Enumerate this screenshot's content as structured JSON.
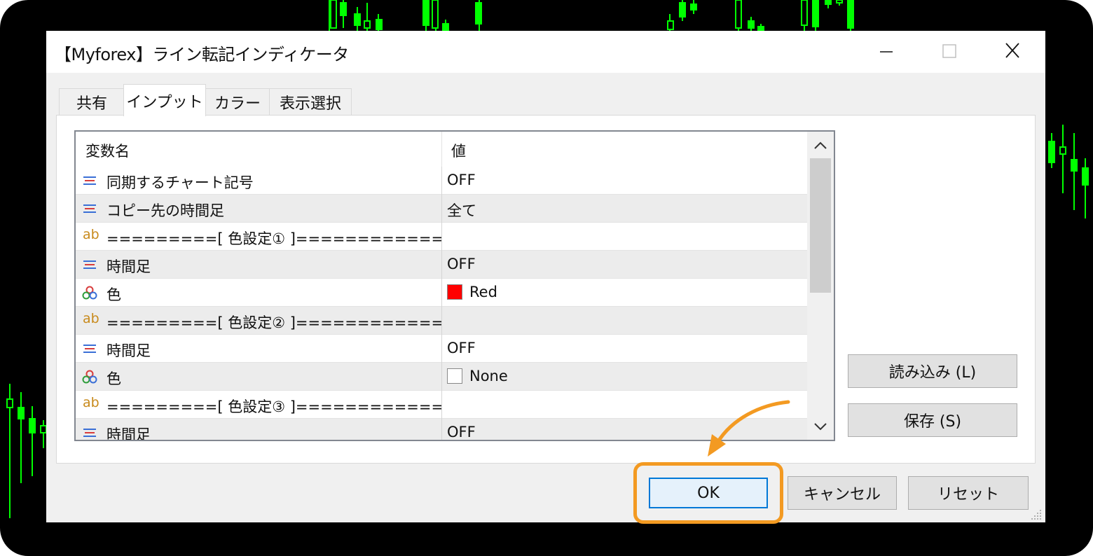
{
  "window": {
    "title": "【Myforex】ライン転記インディケータ",
    "controls": [
      "minimize",
      "maximize",
      "close"
    ]
  },
  "tabs": [
    {
      "label": "共有",
      "active": false
    },
    {
      "label": "インプット",
      "active": true
    },
    {
      "label": "カラー",
      "active": false
    },
    {
      "label": "表示選択",
      "active": false
    }
  ],
  "grid": {
    "columns": [
      "変数名",
      "値"
    ],
    "rows": [
      {
        "icon": "list-lines-icon",
        "name": "同期するチャート記号",
        "value": "OFF"
      },
      {
        "icon": "list-lines-icon",
        "name": "コピー先の時間足",
        "value": "全て"
      },
      {
        "icon": "ab-string-icon",
        "icon_text": "ab",
        "name": "=========[ 色設定① ]============",
        "value": ""
      },
      {
        "icon": "list-lines-icon",
        "name": "時間足",
        "value": "OFF"
      },
      {
        "icon": "color-circles-icon",
        "name": "色",
        "value": "Red",
        "swatch": "#ff0000"
      },
      {
        "icon": "ab-string-icon",
        "icon_text": "ab",
        "name": "=========[ 色設定② ]============",
        "value": ""
      },
      {
        "icon": "list-lines-icon",
        "name": "時間足",
        "value": "OFF"
      },
      {
        "icon": "color-circles-icon",
        "name": "色",
        "value": "None",
        "swatch": "#ffffff"
      },
      {
        "icon": "ab-string-icon",
        "icon_text": "ab",
        "name": "=========[ 色設定③ ]============",
        "value": ""
      },
      {
        "icon": "list-lines-icon",
        "name": "時間足",
        "value": "OFF"
      }
    ]
  },
  "side_buttons": {
    "load": "読み込み (L)",
    "save": "保存 (S)"
  },
  "bottom_buttons": {
    "ok": "OK",
    "cancel": "キャンセル",
    "reset": "リセット"
  },
  "colors": {
    "highlight": "#f39a22",
    "chart_background": "#000000",
    "candle": "#00ff00",
    "focus_border": "#0078d7"
  }
}
